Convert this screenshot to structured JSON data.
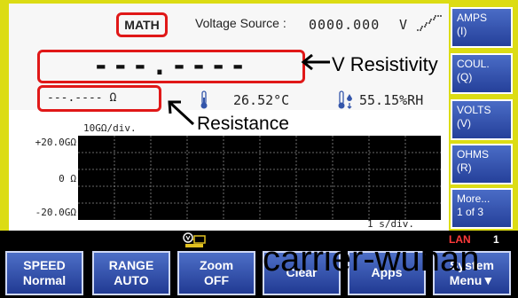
{
  "header": {
    "math_label": "MATH",
    "voltage_source_label": "Voltage Source :",
    "voltage_source_value": "0000.000",
    "voltage_source_unit": "V"
  },
  "readings": {
    "main": "---.----",
    "resistance": "---.---- Ω",
    "temperature": "26.52°C",
    "humidity": "55.15%RH"
  },
  "annotations": {
    "v_resistivity": "V Resistivity",
    "resistance": "Resistance"
  },
  "graph": {
    "scale": "10GΩ/div.",
    "y_top": "+20.0GΩ",
    "y_mid": "0 Ω",
    "y_bottom": "-20.0GΩ",
    "x_scale": "1 s/div."
  },
  "side_menu": [
    {
      "label": "AMPS",
      "key": "(I)"
    },
    {
      "label": "COUL.",
      "key": "(Q)"
    },
    {
      "label": "VOLTS",
      "key": "(V)"
    },
    {
      "label": "OHMS",
      "key": "(R)"
    },
    {
      "label": "More...",
      "key": "1 of 3"
    }
  ],
  "status": {
    "lan": "LAN",
    "lan_count": "1"
  },
  "softkeys": [
    {
      "line1": "SPEED",
      "line2": "Normal"
    },
    {
      "line1": "RANGE",
      "line2": "AUTO"
    },
    {
      "line1": "Zoom",
      "line2": "OFF"
    },
    {
      "line1": "Clear",
      "line2": ""
    },
    {
      "line1": "Apps",
      "line2": ""
    },
    {
      "line1": "System",
      "line2": "Menu▼"
    }
  ],
  "watermark": "carrier-wuhan",
  "colors": {
    "bezel": "#dcdc14",
    "highlight": "#e01818",
    "button": "#2f4fa8"
  }
}
